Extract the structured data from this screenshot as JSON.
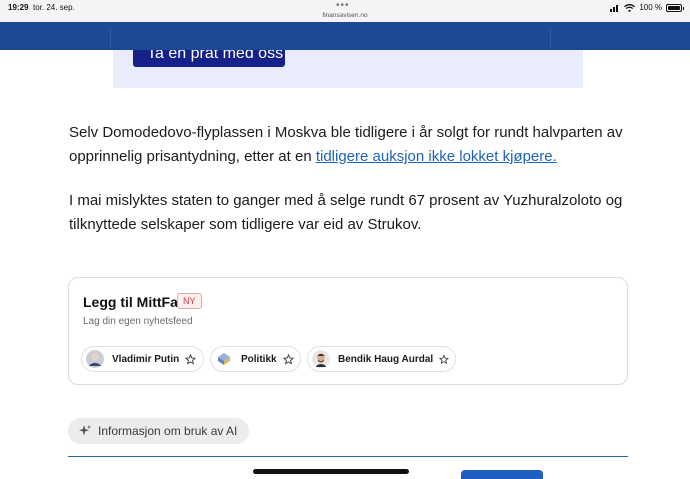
{
  "status_bar": {
    "time": "19:29",
    "date": "tor. 24. sep.",
    "dots": "•••",
    "url": "finansavisen.no",
    "battery": "100 %"
  },
  "ad": {
    "button_label": "Ta en prat med oss"
  },
  "article": {
    "p1_text": "Selv Domodedovo-flyplassen i Moskva ble tidligere i år solgt for rundt halvparten av opprinnelig prisantydning, etter at en ",
    "p1_link": "tidligere auksjon ikke lokket kjøpere.",
    "p2_text": "I mai mislyktes staten to ganger med å selge rundt 67 prosent av Yuzhuralzoloto og tilknyttede selskaper som tidligere var eid av Strukov."
  },
  "mittfa": {
    "title": "Legg til MittFa",
    "badge": "NY",
    "subtitle": "Lag din egen nyhetsfeed",
    "chips": [
      {
        "label": "Vladimir Putin"
      },
      {
        "label": "Politikk"
      },
      {
        "label": "Bendik Haug Aurdal"
      }
    ]
  },
  "ai_info": {
    "label": "Informasjon om bruk av AI"
  },
  "colors": {
    "header_blue": "#1c4894",
    "link_blue": "#1d63b8",
    "badge_red": "#d23b3b"
  }
}
